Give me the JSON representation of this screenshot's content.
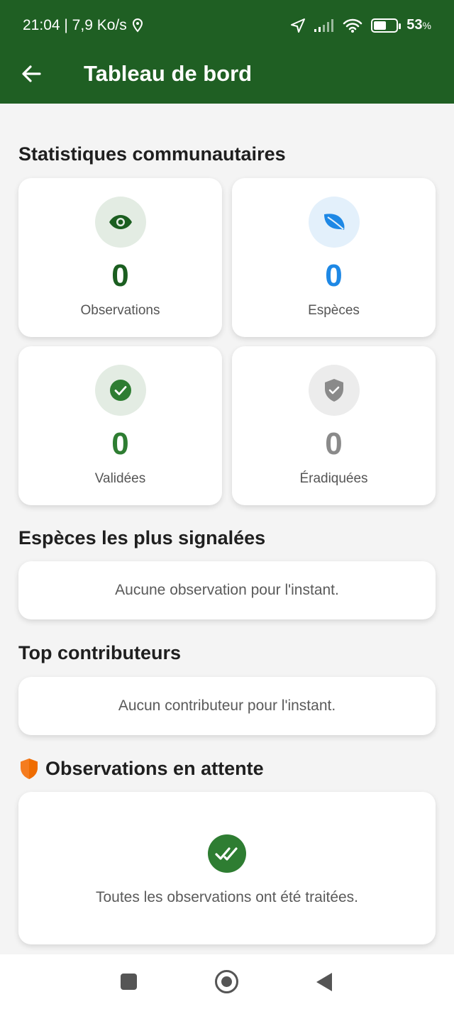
{
  "status_bar": {
    "time_speed": "21:04 | 7,9 Ko/s",
    "battery": "53",
    "battery_unit": "%"
  },
  "appbar": {
    "back_icon": "arrow-left-icon",
    "title": "Tableau de bord"
  },
  "stats": {
    "title": "Statistiques communautaires",
    "cards": [
      {
        "value": "0",
        "label": "Observations",
        "icon": "eye-icon",
        "color": "#1b5e20",
        "bg": "#e3ece3"
      },
      {
        "value": "0",
        "label": "Espèces",
        "icon": "leaf-icon",
        "color": "#1e88e5",
        "bg": "#e3f0fb"
      },
      {
        "value": "0",
        "label": "Validées",
        "icon": "check-circle-icon",
        "color": "#2e7d32",
        "bg": "#e3ece3"
      },
      {
        "value": "0",
        "label": "Éradiquées",
        "icon": "shield-check-icon",
        "color": "#8a8a8a",
        "bg": "#ececec"
      }
    ]
  },
  "top_species": {
    "title": "Espèces les plus signalées",
    "empty": "Aucune observation pour l'instant."
  },
  "top_contributors": {
    "title": "Top contributeurs",
    "empty": "Aucun contributeur pour l'instant."
  },
  "pending": {
    "icon": "shield-icon",
    "title": "Observations en attente",
    "message": "Toutes les observations ont été traitées."
  },
  "colors": {
    "primary": "#1f5f23",
    "accent_orange": "#f57c1f"
  }
}
